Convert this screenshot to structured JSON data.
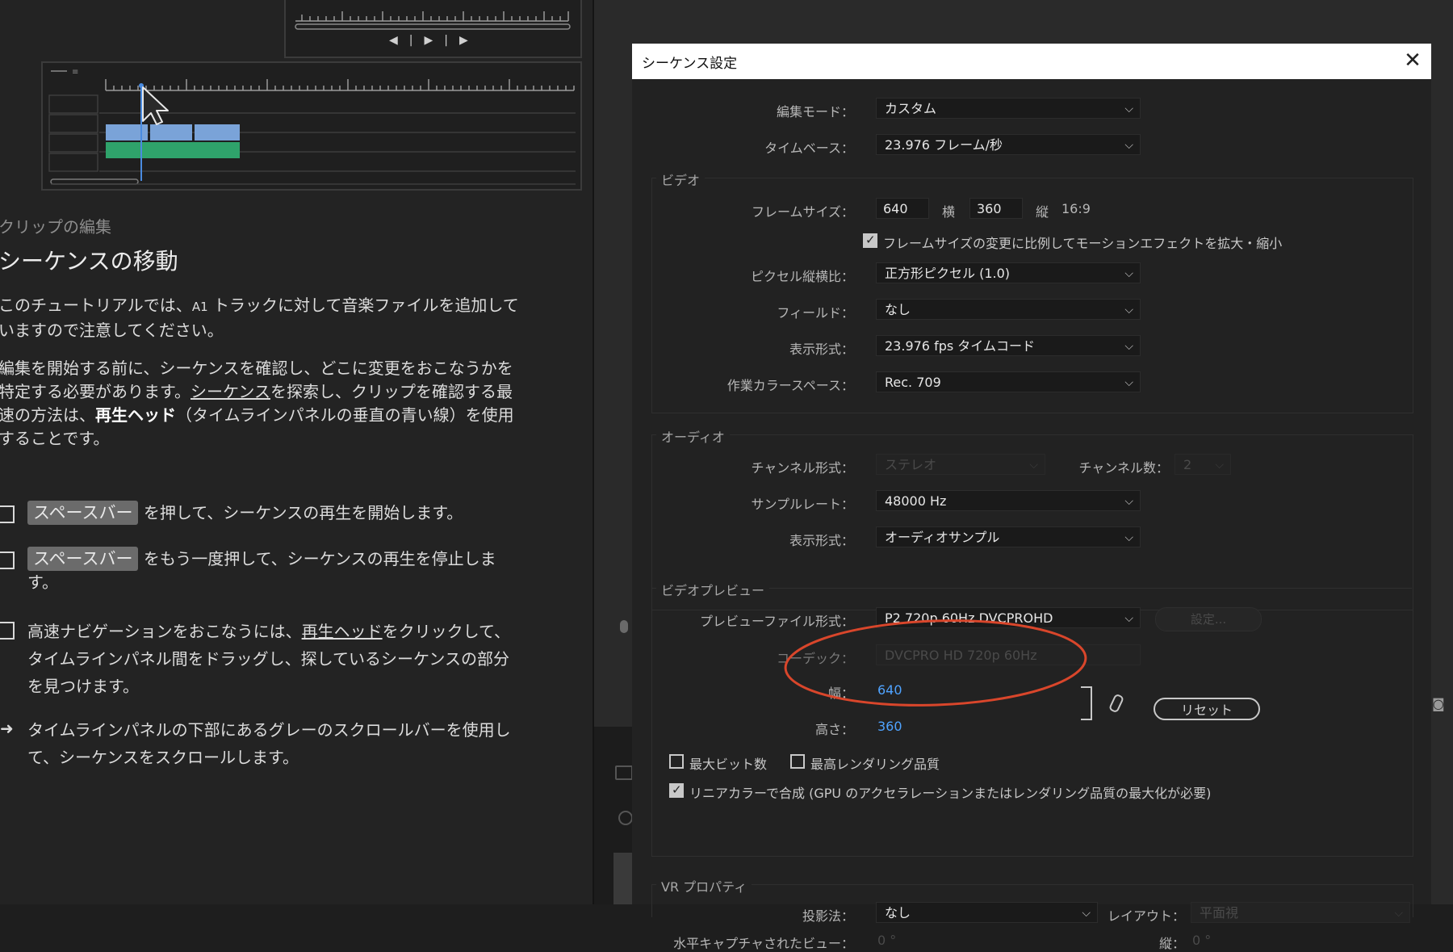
{
  "monitor": {
    "controls": [
      "◀|",
      "▶",
      "|▶"
    ]
  },
  "tutorial": {
    "section_small": "クリップの編集",
    "section_title": "シーケンスの移動",
    "para1_a": "このチュートリアルでは、",
    "para1_a1": "A1",
    "para1_b": " トラックに対して音楽ファイルを追加して",
    "para1_c": "いますので注意してください。",
    "para2_l1": "編集を開始する前に、シーケンスを確認し、どこに変更をおこなうかを",
    "para2_l2a": "特定する必要があります。",
    "para2_l2link": "シーケンス",
    "para2_l2b": "を探索し、クリップを確認する最",
    "para2_l3a": "速の方法は、",
    "para2_l3bold": "再生ヘッド",
    "para2_l3b": "（タイムラインパネルの垂直の青い線）を使用",
    "para2_l4": "することです。",
    "step1_key": "スペースバー",
    "step1_text": "を押して、シーケンスの再生を開始します。",
    "step2_key": "スペースバー",
    "step2_text": "をもう一度押して、シーケンスの再生を停止しま",
    "step2_text2": "す。",
    "step3_a": "高速ナビゲーションをおこなうには、",
    "step3_link": "再生ヘッド",
    "step3_b": "をクリックして、",
    "step3_l2": "タイムラインパネル間をドラッグし、探しているシーケンスの部分",
    "step3_l3": "を見つけます。",
    "step4_arrow": "➜",
    "step4_l1": "タイムラインパネルの下部にあるグレーのスクロールバーを使用し",
    "step4_l2": "て、シーケンスをスクロールします。"
  },
  "dialog": {
    "title": "シーケンス設定",
    "close": "✕",
    "edit_mode_label": "編集モード：",
    "edit_mode_value": "カスタム",
    "timebase_label": "タイムベース：",
    "timebase_value": "23.976  フレーム/秒",
    "video": {
      "group": "ビデオ",
      "frame_size_label": "フレームサイズ：",
      "width": "640",
      "h_label": "横",
      "height": "360",
      "v_label": "縦",
      "aspect": "16:9",
      "scale_checkbox": "フレームサイズの変更に比例してモーションエフェクトを拡大・縮小",
      "pixel_aspect_label": "ピクセル縦横比：",
      "pixel_aspect_value": "正方形ピクセル (1.0)",
      "fields_label": "フィールド：",
      "fields_value": "なし",
      "display_label": "表示形式：",
      "display_value": "23.976  fps タイムコード",
      "colorspace_label": "作業カラースペース：",
      "colorspace_value": "Rec. 709"
    },
    "audio": {
      "group": "オーディオ",
      "channel_format_label": "チャンネル形式：",
      "channel_format_value": "ステレオ",
      "channel_count_label": "チャンネル数：",
      "channel_count_value": "2",
      "sample_rate_label": "サンプルレート：",
      "sample_rate_value": "48000 Hz",
      "display_label": "表示形式：",
      "display_value": "オーディオサンプル"
    },
    "preview": {
      "group": "ビデオプレビュー",
      "file_format_label": "プレビューファイル形式：",
      "file_format_value": "P2 720p 60Hz DVCPROHD",
      "settings_button": "設定...",
      "codec_label": "コーデック：",
      "codec_value": "DVCPRO HD 720p 60Hz",
      "width_label": "幅：",
      "width_value": "640",
      "height_label": "高さ：",
      "height_value": "360",
      "reset_button": "リセット",
      "max_bit_depth": "最大ビット数",
      "max_render_quality": "最高レンダリング品質",
      "linear_color": "リニアカラーで合成 (GPU のアクセラレーションまたはレンダリング品質の最大化が必要)"
    },
    "vr": {
      "group": "VR プロパティ",
      "projection_label": "投影法：",
      "projection_value": "なし",
      "layout_label": "レイアウト：",
      "layout_value": "平面視",
      "h_capture_label": "水平キャプチャされたビュー：",
      "h_capture_value": "0 °",
      "vertical_label": "縦：",
      "vertical_value": "0 °"
    }
  },
  "colors": {
    "highlight_ellipse": "#d9462b",
    "accent_blue": "#4fa3ff"
  }
}
